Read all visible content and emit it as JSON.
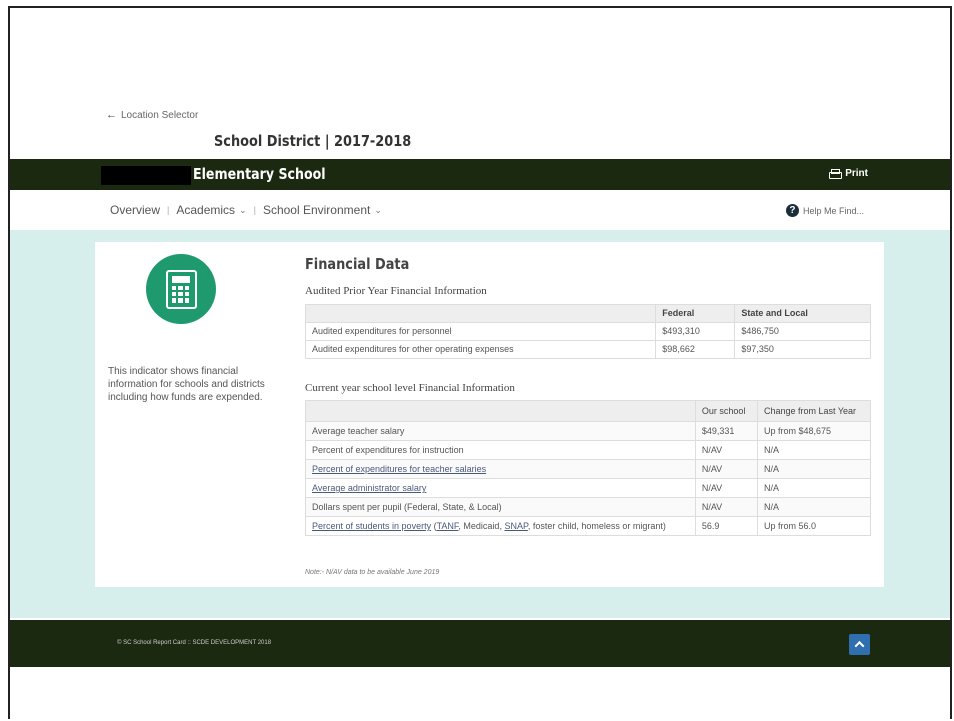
{
  "back_link": "Location Selector",
  "district_title": "School District | 2017-2018",
  "school_name": "Elementary School",
  "print_label": "Print",
  "nav": {
    "overview": "Overview",
    "academics": "Academics",
    "environment": "School Environment"
  },
  "help_label": "Help Me Find...",
  "indicator_text": "This indicator shows financial information for schools and districts including how funds are expended.",
  "financial_title": "Financial Data",
  "audited": {
    "title": "Audited Prior Year Financial Information",
    "headers": [
      "",
      "Federal",
      "State and Local"
    ],
    "rows": [
      [
        "Audited expenditures for personnel",
        "$493,310",
        "$486,750"
      ],
      [
        "Audited expenditures for other operating expenses",
        "$98,662",
        "$97,350"
      ]
    ]
  },
  "current": {
    "title": "Current year school level Financial Information",
    "headers": [
      "",
      "Our school",
      "Change from Last Year"
    ],
    "rows": [
      [
        "Average teacher salary",
        "$49,331",
        "Up from $48,675"
      ],
      [
        "Percent of expenditures for instruction",
        "N/AV",
        "N/A"
      ],
      [
        "Percent of expenditures for teacher salaries",
        "N/AV",
        "N/A"
      ],
      [
        "Average administrator salary",
        "N/AV",
        "N/A"
      ],
      [
        "Dollars spent per pupil (Federal, State, & Local)",
        "N/AV",
        "N/A"
      ]
    ],
    "poverty_row": {
      "link": "Percent of students in poverty",
      "open": " (",
      "tanf": "TANF",
      "mid": ", Medicaid, ",
      "snap": "SNAP",
      "rest": ", foster child, homeless or migrant)",
      "value": "56.9",
      "change": "Up from 56.0"
    }
  },
  "note": "Note:- N/AV data to be available June 2019",
  "footer_text": "© SC School Report Card :: SCDE DEVELOPMENT 2018",
  "colors": {
    "header_bar": "#1c2911",
    "accent_green": "#1f9a6f",
    "teal_band": "#d6efed",
    "top_button": "#2f6fb0"
  }
}
